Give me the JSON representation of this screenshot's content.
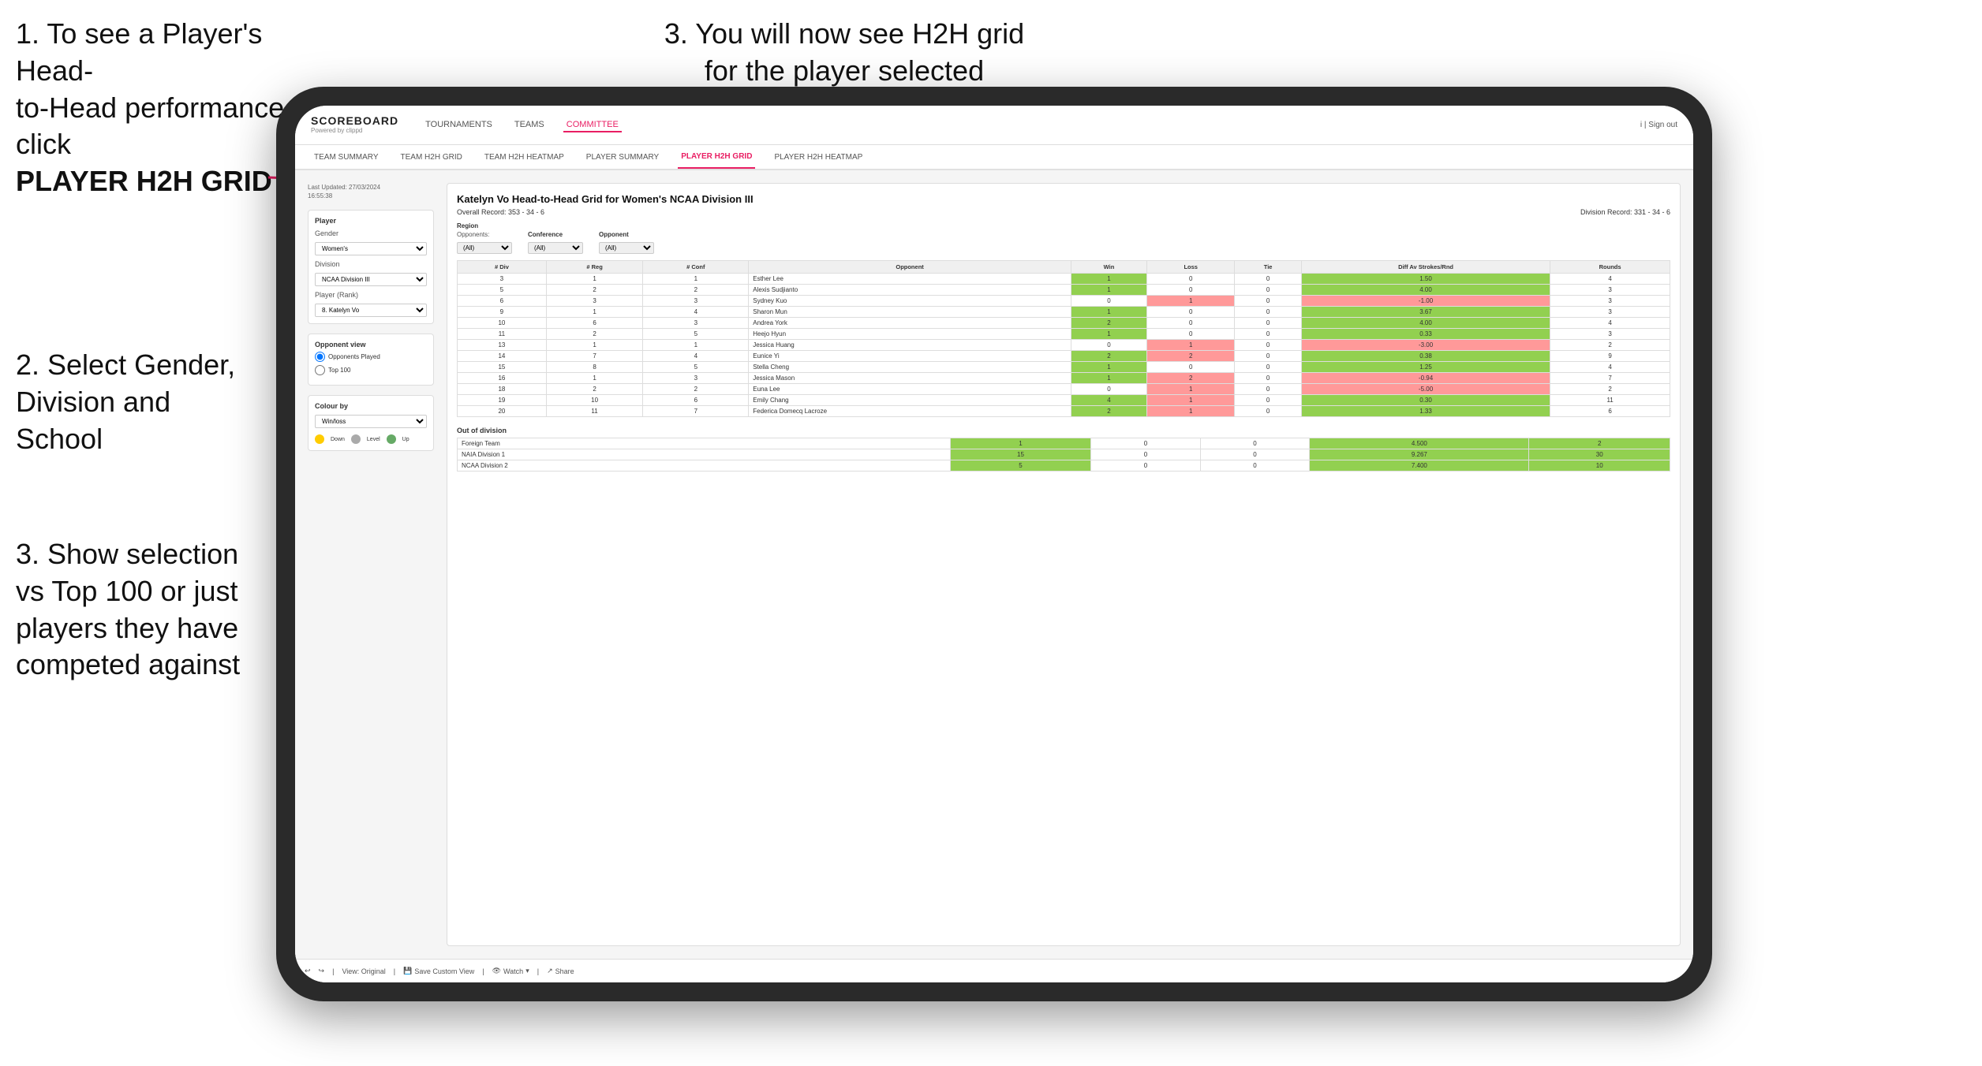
{
  "instructions": {
    "top_left_line1": "1. To see a Player's Head-",
    "top_left_line2": "to-Head performance click",
    "top_left_bold": "PLAYER H2H GRID",
    "top_right": "3. You will now see H2H grid\nfor the player selected",
    "mid_left_title": "2. Select Gender,\nDivision and\nSchool",
    "bot_left_title": "3. Show selection\nvs Top 100 or just\nplayers they have\ncompeted against"
  },
  "nav": {
    "logo_main": "SCOREBOARD",
    "logo_sub": "Powered by clippd",
    "items": [
      "TOURNAMENTS",
      "TEAMS",
      "COMMITTEE"
    ],
    "active_item": "COMMITTEE",
    "sign_out": "Sign out"
  },
  "sub_nav": {
    "items": [
      "TEAM SUMMARY",
      "TEAM H2H GRID",
      "TEAM H2H HEATMAP",
      "PLAYER SUMMARY",
      "PLAYER H2H GRID",
      "PLAYER H2H HEATMAP"
    ],
    "active": "PLAYER H2H GRID"
  },
  "sidebar": {
    "last_updated": "Last Updated: 27/03/2024\n16:55:38",
    "player_label": "Player",
    "gender_label": "Gender",
    "gender_value": "Women's",
    "division_label": "Division",
    "division_value": "NCAA Division III",
    "player_rank_label": "Player (Rank)",
    "player_rank_value": "8. Katelyn Vo",
    "opponent_view_label": "Opponent view",
    "radio1": "Opponents Played",
    "radio2": "Top 100",
    "colour_by_label": "Colour by",
    "colour_by_value": "Win/loss",
    "legend": [
      {
        "color": "#ffcc00",
        "label": "Down"
      },
      {
        "color": "#aaaaaa",
        "label": "Level"
      },
      {
        "color": "#66aa66",
        "label": "Up"
      }
    ]
  },
  "table": {
    "title": "Katelyn Vo Head-to-Head Grid for Women's NCAA Division III",
    "overall_record": "Overall Record: 353 - 34 - 6",
    "division_record": "Division Record: 331 - 34 - 6",
    "region_label": "Region",
    "conference_label": "Conference",
    "opponent_label": "Opponent",
    "opponents_label": "Opponents:",
    "all_option": "(All)",
    "columns": [
      "# Div",
      "# Reg",
      "# Conf",
      "Opponent",
      "Win",
      "Loss",
      "Tie",
      "Diff Av Strokes/Rnd",
      "Rounds"
    ],
    "rows": [
      {
        "div": 3,
        "reg": 1,
        "conf": 1,
        "name": "Esther Lee",
        "win": 1,
        "loss": 0,
        "tie": 0,
        "diff": 1.5,
        "rounds": 4,
        "win_color": "green"
      },
      {
        "div": 5,
        "reg": 2,
        "conf": 2,
        "name": "Alexis Sudjianto",
        "win": 1,
        "loss": 0,
        "tie": 0,
        "diff": 4.0,
        "rounds": 3,
        "win_color": "green"
      },
      {
        "div": 6,
        "reg": 3,
        "conf": 3,
        "name": "Sydney Kuo",
        "win": 0,
        "loss": 1,
        "tie": 0,
        "diff": -1.0,
        "rounds": 3,
        "win_color": "red"
      },
      {
        "div": 9,
        "reg": 1,
        "conf": 4,
        "name": "Sharon Mun",
        "win": 1,
        "loss": 0,
        "tie": 0,
        "diff": 3.67,
        "rounds": 3,
        "win_color": "green"
      },
      {
        "div": 10,
        "reg": 6,
        "conf": 3,
        "name": "Andrea York",
        "win": 2,
        "loss": 0,
        "tie": 0,
        "diff": 4.0,
        "rounds": 4,
        "win_color": "green"
      },
      {
        "div": 11,
        "reg": 2,
        "conf": 5,
        "name": "Heejo Hyun",
        "win": 1,
        "loss": 0,
        "tie": 0,
        "diff": 0.33,
        "rounds": 3,
        "win_color": "yellow"
      },
      {
        "div": 13,
        "reg": 1,
        "conf": 1,
        "name": "Jessica Huang",
        "win": 0,
        "loss": 1,
        "tie": 0,
        "diff": -3.0,
        "rounds": 2,
        "win_color": "red"
      },
      {
        "div": 14,
        "reg": 7,
        "conf": 4,
        "name": "Eunice Yi",
        "win": 2,
        "loss": 2,
        "tie": 0,
        "diff": 0.38,
        "rounds": 9,
        "win_color": "yellow"
      },
      {
        "div": 15,
        "reg": 8,
        "conf": 5,
        "name": "Stella Cheng",
        "win": 1,
        "loss": 0,
        "tie": 0,
        "diff": 1.25,
        "rounds": 4,
        "win_color": "green"
      },
      {
        "div": 16,
        "reg": 1,
        "conf": 3,
        "name": "Jessica Mason",
        "win": 1,
        "loss": 2,
        "tie": 0,
        "diff": -0.94,
        "rounds": 7,
        "win_color": "yellow"
      },
      {
        "div": 18,
        "reg": 2,
        "conf": 2,
        "name": "Euna Lee",
        "win": 0,
        "loss": 1,
        "tie": 0,
        "diff": -5.0,
        "rounds": 2,
        "win_color": "red"
      },
      {
        "div": 19,
        "reg": 10,
        "conf": 6,
        "name": "Emily Chang",
        "win": 4,
        "loss": 1,
        "tie": 0,
        "diff": 0.3,
        "rounds": 11,
        "win_color": "yellow"
      },
      {
        "div": 20,
        "reg": 11,
        "conf": 7,
        "name": "Federica Domecq Lacroze",
        "win": 2,
        "loss": 1,
        "tie": 0,
        "diff": 1.33,
        "rounds": 6,
        "win_color": "yellow"
      }
    ],
    "out_of_division_label": "Out of division",
    "out_of_division_rows": [
      {
        "name": "Foreign Team",
        "win": 1,
        "loss": 0,
        "tie": 0,
        "diff": 4.5,
        "rounds": 2
      },
      {
        "name": "NAIA Division 1",
        "win": 15,
        "loss": 0,
        "tie": 0,
        "diff": 9.267,
        "rounds": 30
      },
      {
        "name": "NCAA Division 2",
        "win": 5,
        "loss": 0,
        "tie": 0,
        "diff": 7.4,
        "rounds": 10
      }
    ]
  },
  "toolbar": {
    "view_original": "View: Original",
    "save_custom": "Save Custom View",
    "watch": "Watch",
    "share": "Share"
  }
}
